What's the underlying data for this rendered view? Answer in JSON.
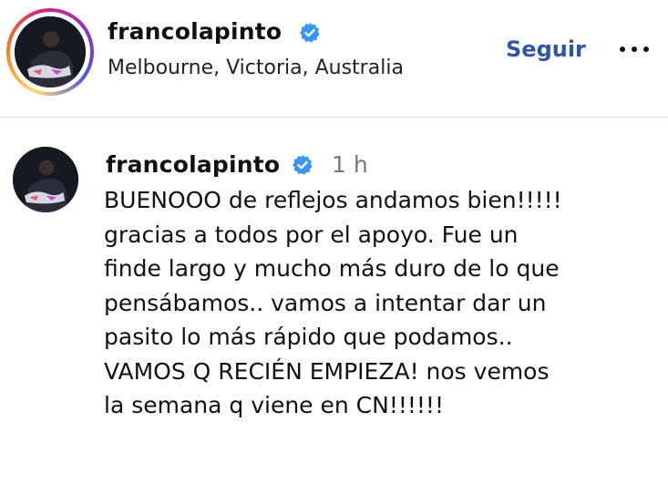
{
  "header": {
    "username": "francolapinto",
    "location": "Melbourne, Victoria, Australia",
    "follow_label": "Seguir",
    "verified_icon": "verified-badge-icon",
    "more_icon": "more-options-icon"
  },
  "comment": {
    "username": "francolapinto",
    "time": "1 h",
    "verified_icon": "verified-badge-icon",
    "lines": [
      "BUENOOO de reflejos andamos bien!!!!!",
      "gracias a todos por el apoyo. Fue un",
      "finde largo y mucho más duro de lo que",
      "pensábamos.. vamos a intentar dar un",
      "pasito lo más rápido que podamos..",
      "VAMOS Q RECIÉN EMPIEZA! nos vemos",
      "la semana q viene en CN!!!!!!"
    ]
  },
  "colors": {
    "accent": "#3154a8",
    "verified": "#3897f0",
    "muted": "#777777",
    "divider": "#dadada"
  }
}
